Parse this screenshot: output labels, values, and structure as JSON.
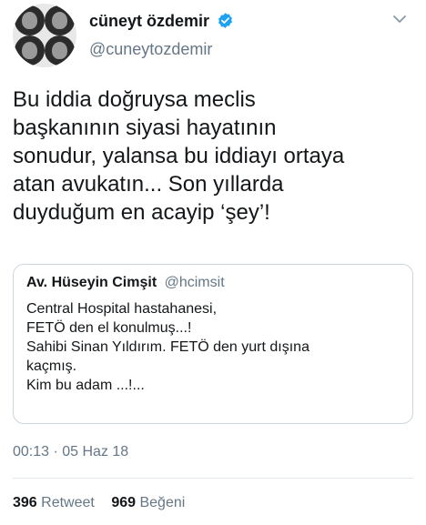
{
  "author": {
    "display_name": "cüneyt özdemir",
    "handle": "@cuneytozdemir",
    "verified": true,
    "accent_color": "#1da1f2"
  },
  "tweet": {
    "lines": [
      "Bu iddia doğruysa meclis",
      "başkanının siyasi hayatının",
      "sonudur, yalansa bu iddiayı ortaya",
      "atan avukatın... Son yıllarda",
      "duyduğum en acayip ‘şey’!"
    ],
    "timestamp": "00:13 · 05 Haz 18"
  },
  "quoted": {
    "display_name": "Av. Hüseyin Cimşit",
    "handle": "@hcimsit",
    "lines": [
      "Central Hospital hastahanesi,",
      "FETÖ den el konulmuş...!",
      "Sahibi Sinan Yıldırım. FETÖ den yurt dışına",
      "kaçmış.",
      "Kim bu adam ...!..."
    ]
  },
  "stats": {
    "retweets_count": "396",
    "retweets_label": "Retweet",
    "likes_count": "969",
    "likes_label": "Beğeni"
  },
  "icons": {
    "verified": "verified-badge-icon",
    "menu": "chevron-down-icon"
  }
}
